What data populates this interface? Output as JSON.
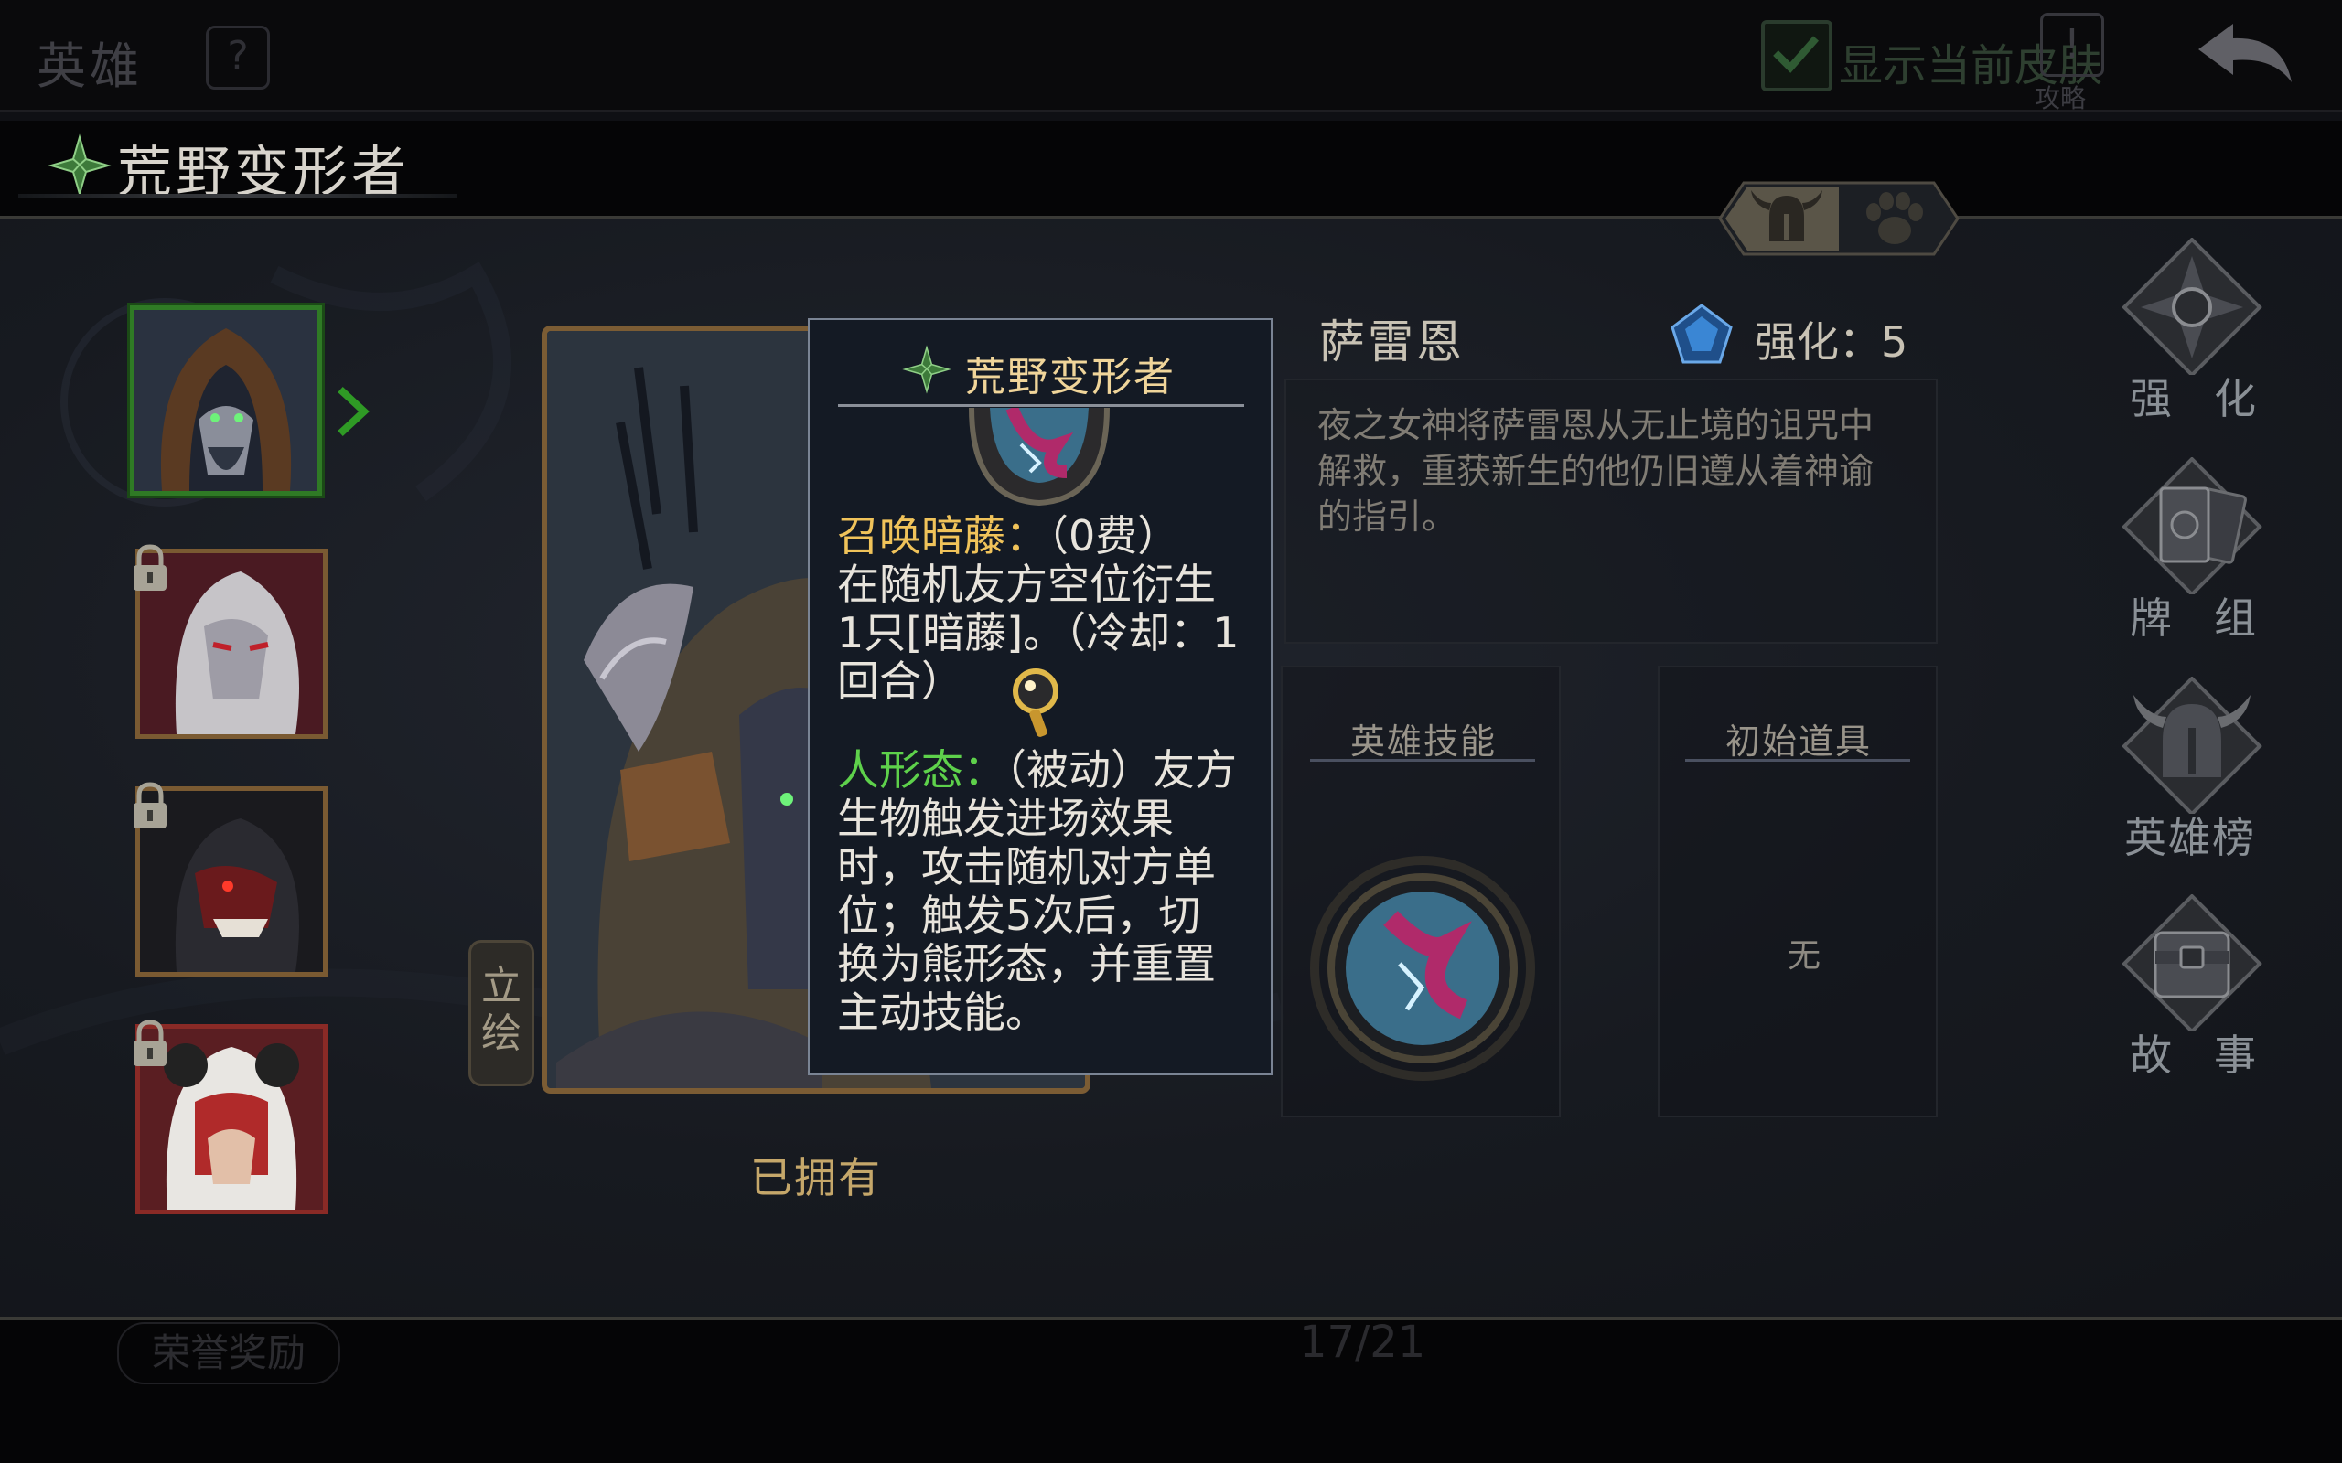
{
  "topbar": {
    "title": "英雄",
    "help_icon": "question-gear-icon",
    "show_skin_label": "显示当前皮肤",
    "guide_label": "攻略",
    "back_icon": "back-arrow-icon"
  },
  "class_header": {
    "name": "荒野变形者",
    "icon": "leaf-emblem-icon"
  },
  "tabs": [
    {
      "name": "helmet-tab",
      "icon": "horned-helmet-icon",
      "active": true
    },
    {
      "name": "paw-tab",
      "icon": "paw-icon",
      "active": false
    }
  ],
  "portraits": [
    {
      "name": "hooded-elder",
      "selected": true,
      "locked": false
    },
    {
      "name": "white-haired-vampire",
      "selected": false,
      "locked": true
    },
    {
      "name": "masked-demon",
      "selected": false,
      "locked": true
    },
    {
      "name": "panda-hood-girl",
      "selected": false,
      "locked": true
    }
  ],
  "art_panel": {
    "vertical_button": "立绘",
    "owned_label": "已拥有"
  },
  "tooltip": {
    "title": "荒野变形者",
    "skill1_name": "召唤暗藤：",
    "skill1_cost": "（0费）",
    "skill1_desc": "在随机友方空位衍生1只[暗藤]。（冷却：1回合）",
    "skill2_name": "人形态：",
    "skill2_desc": "（被动）友方生物触发进场效果时，攻击随机对方单位；触发5次后，切换为熊形态，并重置主动技能。"
  },
  "hero": {
    "name": "萨雷恩",
    "enhance_label": "强化：",
    "enhance_level": "5",
    "description": "夜之女神将萨雷恩从无止境的诅咒中解救，重获新生的他仍旧遵从着神谕的指引。",
    "skill_slot_title": "英雄技能",
    "item_slot_title": "初始道具",
    "item_slot_value": "无"
  },
  "right_menu": [
    {
      "label": "强化",
      "icon": "compass-star-icon"
    },
    {
      "label": "牌组",
      "icon": "card-deck-icon"
    },
    {
      "label": "英雄榜",
      "icon": "helmet-banner-icon"
    },
    {
      "label": "故事",
      "icon": "chest-icon"
    }
  ],
  "bottom": {
    "reward_label": "荣誉奖励",
    "page_count": "17/21"
  },
  "colors": {
    "gold_text": "#f0c35a",
    "green_text": "#5ed14b",
    "frame_gold": "#7b5c34",
    "select_green": "#2f7a25"
  }
}
